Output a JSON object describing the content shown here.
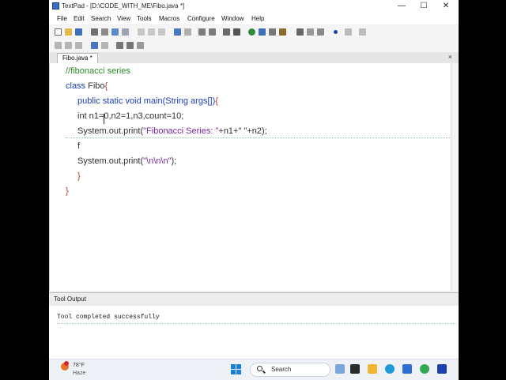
{
  "window": {
    "title": "TextPad - [D:\\CODE_WITH_ME\\Fibo.java *]",
    "minimize": "—",
    "maximize": "☐",
    "close": "✕"
  },
  "menu": [
    "File",
    "Edit",
    "Search",
    "View",
    "Tools",
    "Macros",
    "Configure",
    "Window",
    "Help"
  ],
  "tab": {
    "label": "Fibo.java *",
    "close": "×"
  },
  "code": {
    "comment": "//fibonacci series",
    "class_kw": "class",
    "class_name": " Fibo",
    "class_brace": "{",
    "main_sig": "public static void main(String args[])",
    "main_brace": "{",
    "decl": "int n1=0,n2=1,n3,count=10;",
    "print1_pre": "System.out.print(",
    "print1_str": "\"Fibonacci Series: \"",
    "print1_post": "+n1+\" \"+n2);",
    "typing": "f",
    "print2_pre": "System.out.print(",
    "print2_str": "\"\\n\\n\\n\"",
    "print2_post": ");",
    "close_inner": "}",
    "close_outer": "}"
  },
  "output": {
    "title": "Tool Output",
    "message": "Tool completed successfully"
  },
  "taskbar": {
    "weather_temp": "78°F",
    "weather_desc": "Haze",
    "search_label": "Search"
  }
}
